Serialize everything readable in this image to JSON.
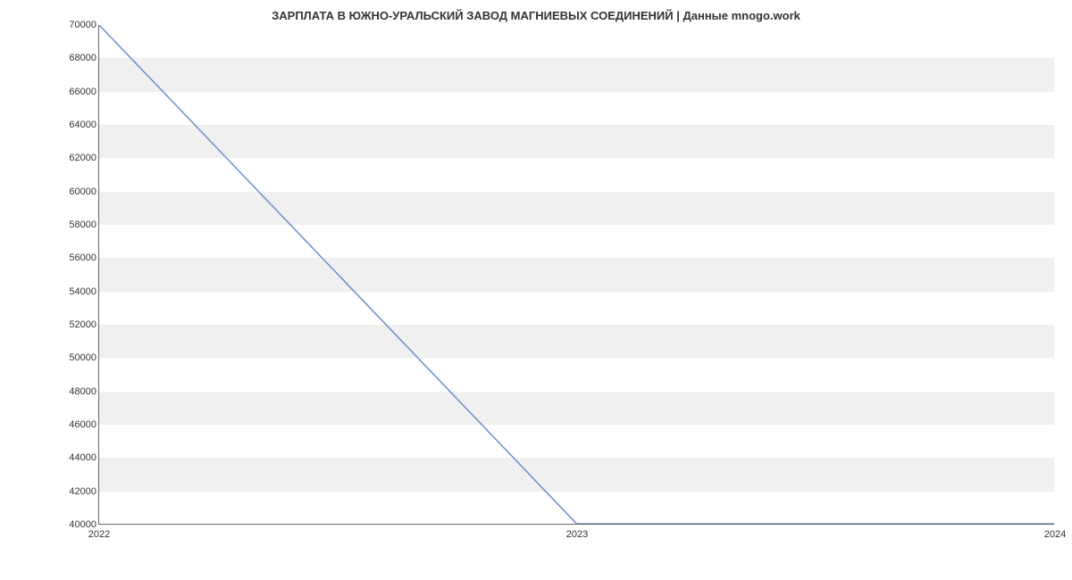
{
  "chart_data": {
    "type": "line",
    "title": "ЗАРПЛАТА В ЮЖНО-УРАЛЬСКИЙ ЗАВОД МАГНИЕВЫХ СОЕДИНЕНИЙ | Данные mnogo.work",
    "xlabel": "",
    "ylabel": "",
    "x": [
      "2022",
      "2023",
      "2024"
    ],
    "values": [
      70000,
      40000,
      40000
    ],
    "x_ticks": [
      "2022",
      "2023",
      "2024"
    ],
    "y_ticks": [
      40000,
      42000,
      44000,
      46000,
      48000,
      50000,
      52000,
      54000,
      56000,
      58000,
      60000,
      62000,
      64000,
      66000,
      68000,
      70000
    ],
    "ylim": [
      40000,
      70000
    ],
    "xlim_indices": [
      0,
      2
    ],
    "line_color": "#6a8fc9",
    "grid_band_color": "#f0f0f0"
  }
}
